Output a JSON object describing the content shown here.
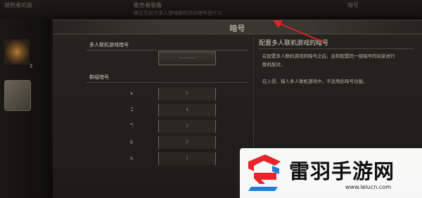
{
  "background": {
    "tabs": [
      "褪色者的装",
      "能色者装备",
      "暗号"
    ],
    "subtitle": "被召至前方多人游戏联机时的暗号是什么",
    "slot_count": "2"
  },
  "dialog": {
    "title": "暗号",
    "multiplay_label": "多人联机游戏暗号",
    "multiplay_value": "————",
    "group_label": "群组暗号",
    "groups": [
      {
        "icon": "ɤ",
        "value": "5"
      },
      {
        "icon": "ℷ",
        "value": "4"
      },
      {
        "icon": "ℸ",
        "value": "3"
      },
      {
        "icon": "ϙ",
        "value": "2"
      },
      {
        "icon": "ϡ",
        "value": "1"
      }
    ],
    "help_title": "配置多人联机游戏的暗号",
    "help_paragraphs": [
      "在配置多人联机游戏的暗号之后，会和配置同一组暗号的玩家进行联机配对。",
      "在入侵、猎人多人联机游戏中，不适用此暗号功能。"
    ]
  },
  "watermark": {
    "text": "雷羽手游网",
    "url": "www.leiucn.com"
  },
  "colors": {
    "annotation_red": "#d8242a",
    "watermark_red": "#e5252b",
    "watermark_blue": "#1f7dd8"
  }
}
